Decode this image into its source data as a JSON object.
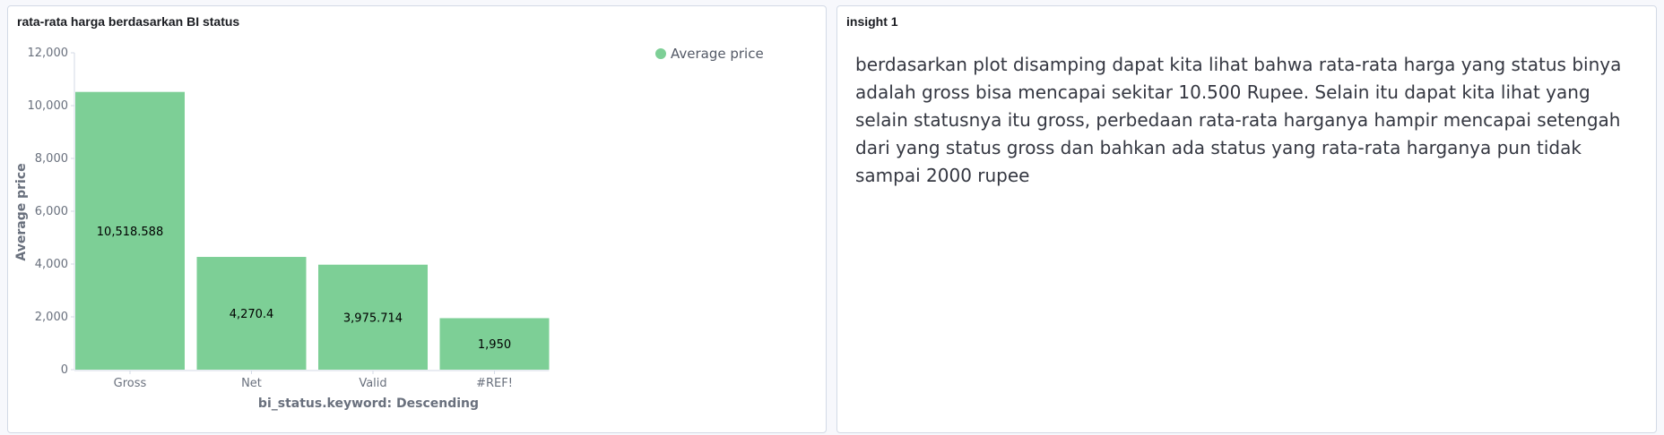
{
  "chart_panel": {
    "title": "rata-rata harga berdasarkan BI status"
  },
  "insight_panel": {
    "title": "insight 1",
    "text": "berdasarkan plot disamping dapat kita lihat bahwa rata-rata harga yang status binya adalah gross bisa mencapai sekitar 10.500 Rupee. Selain itu dapat kita lihat yang selain statusnya itu gross, perbedaan rata-rata harganya hampir mencapai setengah dari yang status gross dan bahkan ada status yang rata-rata harganya pun tidak sampai 2000 rupee"
  },
  "chart_data": {
    "type": "bar",
    "categories": [
      "Gross",
      "Net",
      "Valid",
      "#REF!"
    ],
    "series": [
      {
        "name": "Average price",
        "values": [
          10518.588,
          4270.4,
          3975.714,
          1950
        ],
        "value_labels": [
          "10,518.588",
          "4,270.4",
          "3,975.714",
          "1,950"
        ],
        "color": "#7dcf96"
      }
    ],
    "xlabel": "bi_status.keyword: Descending",
    "ylabel": "Average price",
    "ylim": [
      0,
      12000
    ],
    "yticks": [
      0,
      2000,
      4000,
      6000,
      8000,
      10000,
      12000
    ],
    "ytick_labels": [
      "0",
      "2,000",
      "4,000",
      "6,000",
      "8,000",
      "10,000",
      "12,000"
    ],
    "legend_position": "top-right",
    "grid": false
  }
}
